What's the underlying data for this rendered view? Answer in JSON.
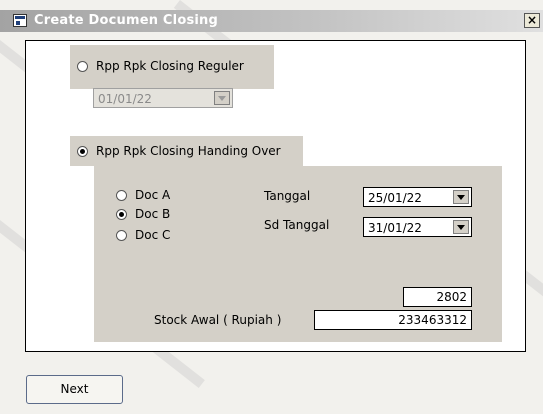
{
  "window": {
    "title": "Create Documen Closing",
    "close_glyph": "×"
  },
  "options": {
    "reguler_label": "Rpp Rpk Closing Reguler",
    "reguler_date": "01/01/22",
    "handover_label": "Rpp Rpk Closing Handing Over"
  },
  "docs": [
    {
      "label": "Doc A",
      "checked": false
    },
    {
      "label": "Doc B",
      "checked": true
    },
    {
      "label": "Doc C",
      "checked": false
    }
  ],
  "fields": {
    "tanggal_label": "Tanggal",
    "tanggal_value": "25/01/22",
    "sd_tanggal_label": "Sd Tanggal",
    "sd_tanggal_value": "31/01/22",
    "count_value": "2802",
    "stock_label": "Stock Awal ( Rupiah )",
    "stock_value": "233463312"
  },
  "buttons": {
    "next": "Next"
  },
  "icons": {
    "window_icon": "app-form-icon",
    "close_icon": "close-icon",
    "dropdown_icon": "chevron-down-icon"
  }
}
